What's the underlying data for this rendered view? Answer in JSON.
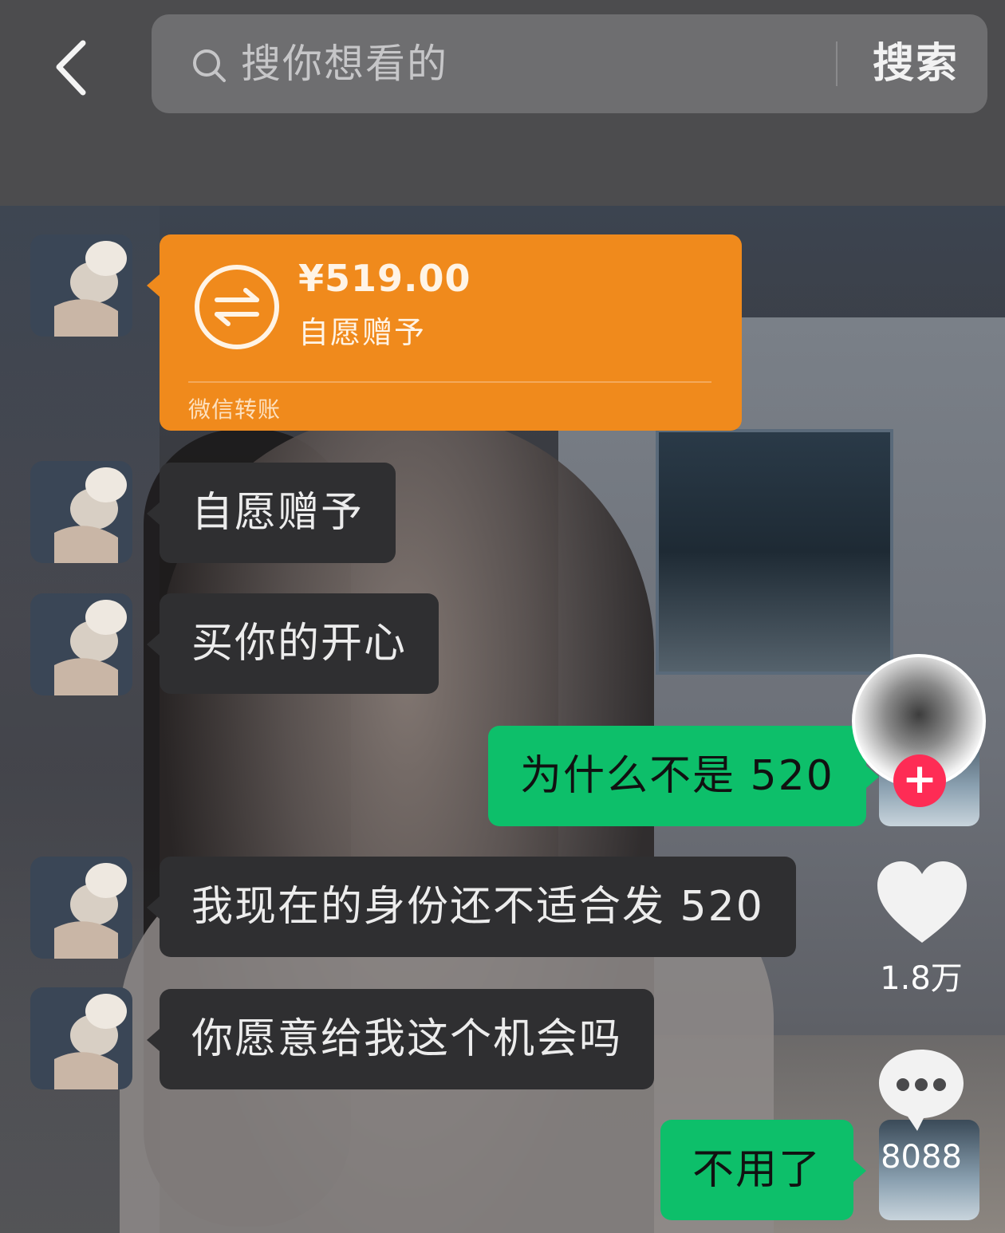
{
  "search": {
    "placeholder": "搜你想看的",
    "button_label": "搜索"
  },
  "transfer": {
    "amount": "¥519.00",
    "note": "自愿赠予",
    "source": "微信转账"
  },
  "messages": [
    {
      "side": "left",
      "text": "自愿赠予"
    },
    {
      "side": "left",
      "text": "买你的开心"
    },
    {
      "side": "right",
      "text": "为什么不是 520"
    },
    {
      "side": "left",
      "text": "我现在的身份还不适合发 520"
    },
    {
      "side": "left",
      "text": "你愿意给我这个机会吗"
    },
    {
      "side": "right",
      "text": "不用了"
    }
  ],
  "actions": {
    "follow_symbol": "+",
    "like_count": "1.8万",
    "comment_count": "8088"
  },
  "colors": {
    "transfer_orange": "#f08a1c",
    "sent_green": "#0dbf6a",
    "received_dark": "#2f2f31",
    "follow_red": "#fe2c55"
  },
  "icons": [
    "back-arrow-icon",
    "search-icon",
    "transfer-arrows-icon",
    "heart-icon",
    "comment-icon",
    "plus-icon"
  ]
}
